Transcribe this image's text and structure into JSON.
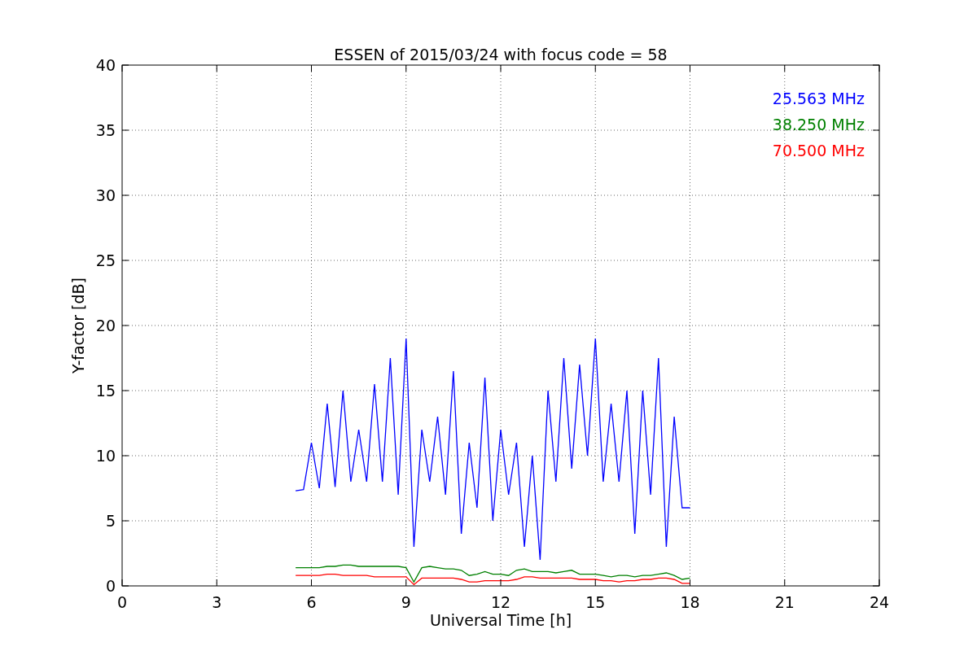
{
  "chart": {
    "chart_data": {
      "type": "line",
      "title": "ESSEN of 2015/03/24 with focus code = 58",
      "xlabel": "Universal Time [h]",
      "ylabel": "Y-factor [dB]",
      "x": [
        5.5,
        5.75,
        6,
        6.25,
        6.5,
        6.75,
        7,
        7.25,
        7.5,
        7.75,
        8,
        8.25,
        8.5,
        8.75,
        9,
        9.25,
        9.5,
        9.75,
        10,
        10.25,
        10.5,
        10.75,
        11,
        11.25,
        11.5,
        11.75,
        12,
        12.25,
        12.5,
        12.75,
        13,
        13.25,
        13.5,
        13.75,
        14,
        14.25,
        14.5,
        14.75,
        15,
        15.25,
        15.5,
        15.75,
        16,
        16.25,
        16.5,
        16.75,
        17,
        17.25,
        17.5,
        17.75,
        18
      ],
      "series": [
        {
          "name": "25.563 MHz",
          "color": "#0000ff",
          "values": [
            7.3,
            7.4,
            11,
            7.5,
            14,
            7.6,
            15,
            8,
            12,
            8,
            15.5,
            8,
            17.5,
            7,
            19,
            3,
            12,
            8,
            13,
            7,
            16.5,
            4,
            11,
            6,
            16,
            5,
            12,
            7,
            11,
            3,
            10,
            2,
            15,
            8,
            17.5,
            9,
            17,
            10,
            19,
            8,
            14,
            8,
            15,
            4,
            15,
            7,
            17.5,
            3,
            13,
            6,
            6
          ]
        },
        {
          "name": "38.250 MHz",
          "color": "#008000",
          "values": [
            1.4,
            1.4,
            1.4,
            1.4,
            1.5,
            1.5,
            1.6,
            1.6,
            1.5,
            1.5,
            1.5,
            1.5,
            1.5,
            1.5,
            1.4,
            0.3,
            1.4,
            1.5,
            1.4,
            1.3,
            1.3,
            1.2,
            0.8,
            0.9,
            1.1,
            0.9,
            0.9,
            0.8,
            1.2,
            1.3,
            1.1,
            1.1,
            1.1,
            1.0,
            1.1,
            1.2,
            0.9,
            0.9,
            0.9,
            0.8,
            0.7,
            0.8,
            0.8,
            0.7,
            0.8,
            0.8,
            0.9,
            1.0,
            0.8,
            0.5,
            0.6
          ]
        },
        {
          "name": "70.500 MHz",
          "color": "#ff0000",
          "values": [
            0.8,
            0.8,
            0.8,
            0.8,
            0.9,
            0.9,
            0.8,
            0.8,
            0.8,
            0.8,
            0.7,
            0.7,
            0.7,
            0.7,
            0.7,
            0.1,
            0.6,
            0.6,
            0.6,
            0.6,
            0.6,
            0.5,
            0.3,
            0.3,
            0.4,
            0.4,
            0.4,
            0.4,
            0.5,
            0.7,
            0.7,
            0.6,
            0.6,
            0.6,
            0.6,
            0.6,
            0.5,
            0.5,
            0.5,
            0.4,
            0.4,
            0.3,
            0.4,
            0.4,
            0.5,
            0.5,
            0.6,
            0.6,
            0.5,
            0.2,
            0.2
          ]
        }
      ],
      "xlim": [
        0,
        24
      ],
      "ylim": [
        0,
        40
      ],
      "xticks": [
        0,
        3,
        6,
        9,
        12,
        15,
        18,
        21,
        24
      ],
      "yticks": [
        0,
        5,
        10,
        15,
        20,
        25,
        30,
        35,
        40
      ],
      "grid": true
    }
  }
}
